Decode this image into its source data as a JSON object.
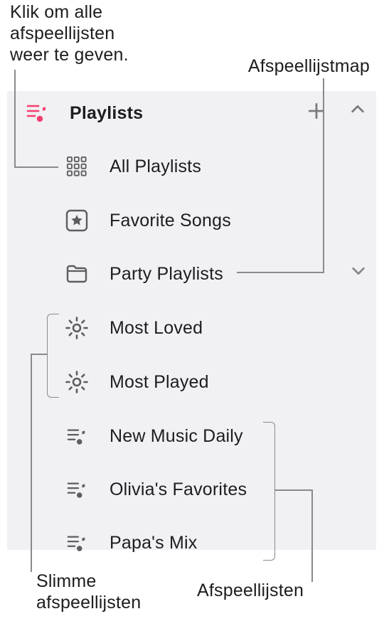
{
  "callouts": {
    "all_playlists": "Klik om alle\nafspeellijsten\nweer te geven.",
    "folder": "Afspeellijstmap",
    "smart": "Slimme\nafspeellijsten",
    "playlists": "Afspeellijsten"
  },
  "sidebar": {
    "header": "Playlists",
    "items": [
      {
        "label": "All Playlists",
        "kind": "all"
      },
      {
        "label": "Favorite Songs",
        "kind": "favorites"
      },
      {
        "label": "Party Playlists",
        "kind": "folder",
        "expanded": false
      },
      {
        "label": "Most Loved",
        "kind": "smart"
      },
      {
        "label": "Most Played",
        "kind": "smart"
      },
      {
        "label": "New Music Daily",
        "kind": "playlist"
      },
      {
        "label": "Olivia's Favorites",
        "kind": "playlist"
      },
      {
        "label": "Papa's Mix",
        "kind": "playlist"
      }
    ]
  },
  "colors": {
    "accent": "#f43e6f",
    "panel_bg": "#f1f0f2",
    "icon_gray": "#5d5d61",
    "chevron_gray": "#87878b",
    "connector_gray": "#8a8a8e",
    "text": "#1d1d1f"
  }
}
